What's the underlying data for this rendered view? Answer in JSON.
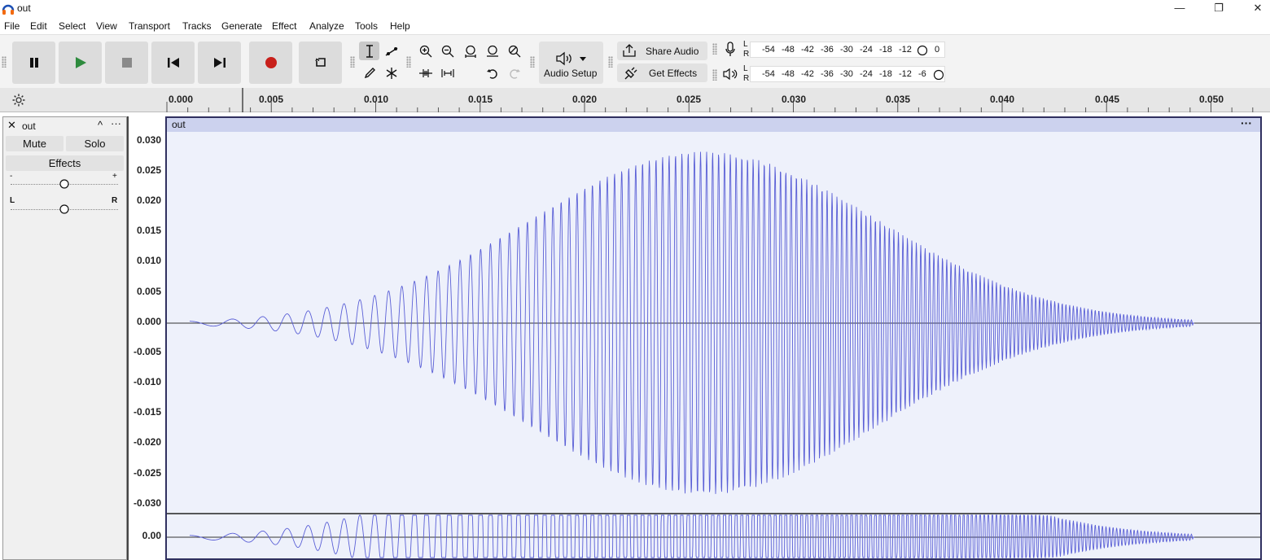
{
  "window": {
    "title": "out",
    "controls": [
      "minimize-icon",
      "restore-icon",
      "close-icon"
    ]
  },
  "menu": [
    "File",
    "Edit",
    "Select",
    "View",
    "Transport",
    "Tracks",
    "Generate",
    "Effect",
    "Analyze",
    "Tools",
    "Help"
  ],
  "toolbar": {
    "transport": [
      "pause-icon",
      "play-icon",
      "stop-icon",
      "skip-start-icon",
      "skip-end-icon",
      "record-icon",
      "loop-icon"
    ],
    "audio_setup_label": "Audio Setup",
    "share_audio_label": "Share Audio",
    "get_effects_label": "Get Effects",
    "meter_ticks": [
      "-54",
      "-48",
      "-42",
      "-36",
      "-30",
      "-24",
      "-18",
      "-12"
    ],
    "rec_meter_end": "0",
    "play_meter_end": "-6",
    "channel_left": "L",
    "channel_right": "R"
  },
  "timeline": {
    "ticks": [
      "0.000",
      "0.005",
      "0.010",
      "0.015",
      "0.020",
      "0.025",
      "0.030",
      "0.035",
      "0.040",
      "0.045",
      "0.050"
    ]
  },
  "track": {
    "name": "out",
    "mute_label": "Mute",
    "solo_label": "Solo",
    "effects_label": "Effects",
    "gain_minus": "-",
    "gain_plus": "+",
    "pan_left": "L",
    "pan_right": "R",
    "clip_name": "out",
    "amplitude_labels": [
      "0.030",
      "0.025",
      "0.020",
      "0.015",
      "0.010",
      "0.005",
      "0.000",
      "-0.005",
      "-0.010",
      "-0.015",
      "-0.020",
      "-0.025",
      "-0.030"
    ],
    "channel2_label": "0.00"
  },
  "colors": {
    "waveform": "#5a5fd6",
    "clip_bg": "#eef1fb",
    "clip_header": "#ccd2ee",
    "record": "#c8201b",
    "play": "#2e8b3e"
  }
}
